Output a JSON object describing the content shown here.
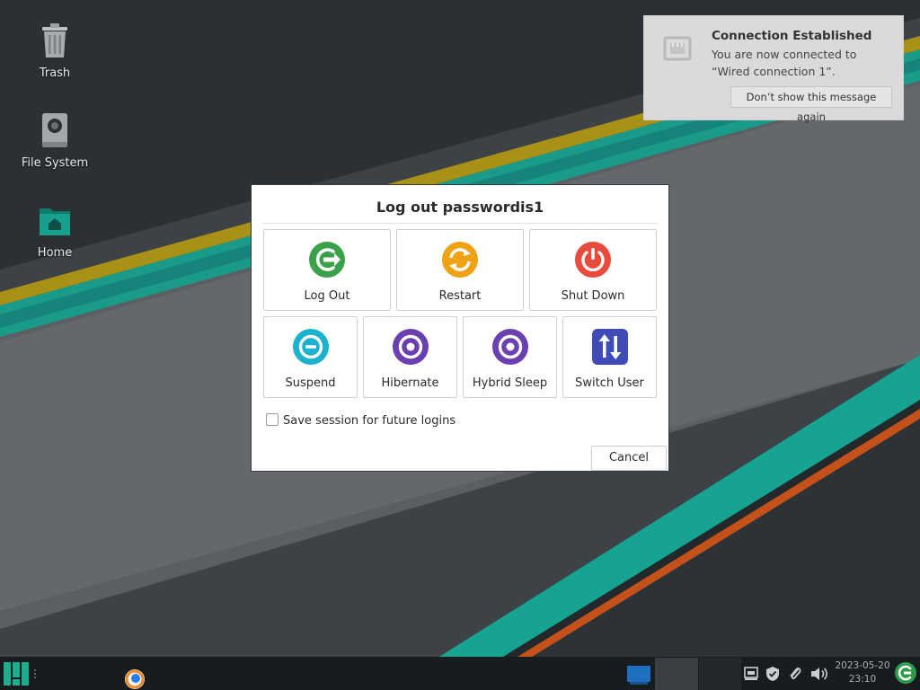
{
  "desktop": {
    "icons": [
      {
        "label": "Trash",
        "icon": "trash-icon"
      },
      {
        "label": "File System",
        "icon": "drive-icon"
      },
      {
        "label": "Home",
        "icon": "folder-home-icon"
      }
    ],
    "colors": {
      "background": "#2a2f33",
      "yellow_stripe": "#b59a0c",
      "teal_stripe": "#119c8a",
      "orange_stripe": "#c5481a",
      "light_panel": "#5f6367"
    }
  },
  "notification": {
    "title": "Connection Established",
    "body": "You are now connected to “Wired connection 1”.",
    "button_label": "Don’t show this message again",
    "icon": "network-wired-icon"
  },
  "dialog": {
    "title": "Log out passwordis1",
    "actions": [
      {
        "label": "Log Out",
        "icon": "logout-icon",
        "color": "#3aa14a"
      },
      {
        "label": "Restart",
        "icon": "restart-icon",
        "color": "#f0a215"
      },
      {
        "label": "Shut Down",
        "icon": "power-icon",
        "color": "#e84a3c"
      },
      {
        "label": "Suspend",
        "icon": "suspend-icon",
        "color": "#1ab2cf"
      },
      {
        "label": "Hibernate",
        "icon": "hibernate-icon",
        "color": "#6a3fb0"
      },
      {
        "label": "Hybrid Sleep",
        "icon": "hybrid-sleep-icon",
        "color": "#6a3fb0"
      },
      {
        "label": "Switch User",
        "icon": "switch-user-icon",
        "color": "#3f4cb8"
      }
    ],
    "save_session_label": "Save session for future logins",
    "save_session_checked": false,
    "cancel_label": "Cancel"
  },
  "taskbar": {
    "date": "2023-05-20",
    "time": "23:10",
    "tray_icons": [
      "network-wired-icon",
      "shield-icon",
      "paperclip-icon",
      "volume-icon",
      "update-icon"
    ],
    "launcher_icons": [
      "manjaro-menu-icon",
      "firefox-icon"
    ]
  }
}
